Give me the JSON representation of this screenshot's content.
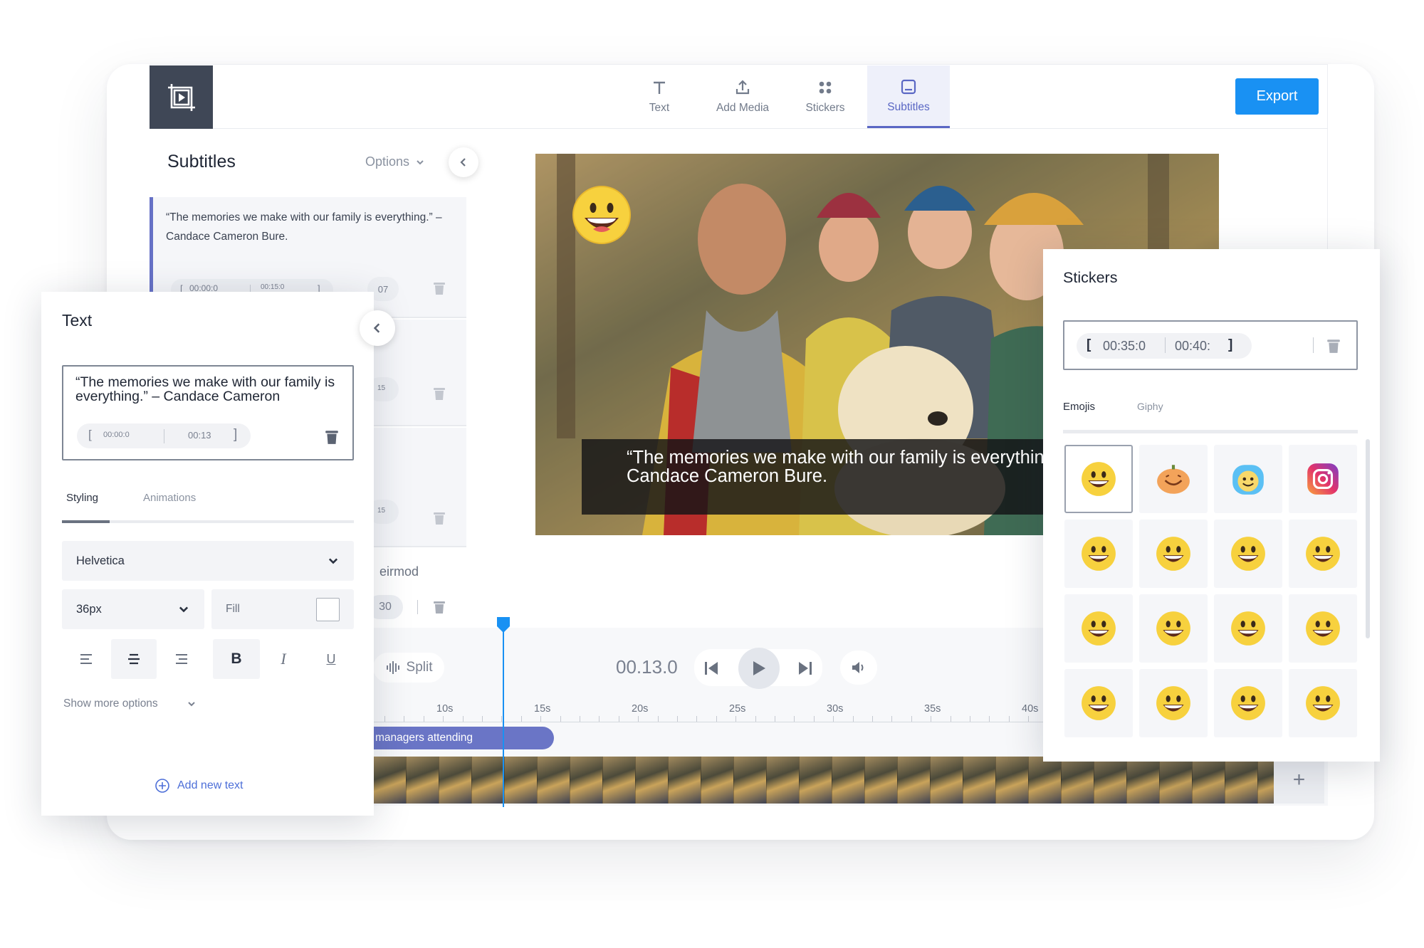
{
  "nav": {
    "tabs": [
      {
        "label": "Text",
        "icon": "text-icon"
      },
      {
        "label": "Add Media",
        "icon": "upload-icon"
      },
      {
        "label": "Stickers",
        "icon": "stickers-icon"
      },
      {
        "label": "Subtitles",
        "icon": "subtitles-icon",
        "active": true
      }
    ],
    "export_label": "Export"
  },
  "subtitles": {
    "title": "Subtitles",
    "options_label": "Options",
    "items": [
      {
        "text": "“The memories we make with our family is everything.” – Candace Cameron Bure.",
        "start": "00:00:0",
        "end": "00:15:0",
        "duration": "07"
      },
      {
        "duration": "15"
      },
      {
        "duration": "15"
      },
      {
        "text": "eirmod",
        "duration": "30"
      }
    ]
  },
  "text_panel": {
    "title": "Text",
    "value": "“The memories we make with our family is everything.” – Candace Cameron",
    "start": "00:00:0",
    "end": "00:13",
    "tabs": [
      "Styling",
      "Animations"
    ],
    "font": "Helvetica",
    "size": "36px",
    "fill_label": "Fill",
    "bold": "B",
    "italic": "I",
    "underline": "U",
    "show_more": "Show more options",
    "add_text": "Add new text"
  },
  "video": {
    "caption": "“The memories we make with our family is everything.” – Candace Cameron Bure."
  },
  "timeline": {
    "split_label": "Split",
    "current_time": "00.13.0",
    "ruler": [
      "10s",
      "15s",
      "20s",
      "25s",
      "30s",
      "35s",
      "40s"
    ],
    "clip_label": "managers attending",
    "add_label": "+"
  },
  "stickers": {
    "title": "Stickers",
    "start": "00:35:0",
    "end": "00:40:",
    "tabs": [
      "Emojis",
      "Giphy"
    ]
  },
  "colors": {
    "accent": "#5a67c4",
    "export": "#1991f3",
    "logo_bg": "#3f4756"
  }
}
